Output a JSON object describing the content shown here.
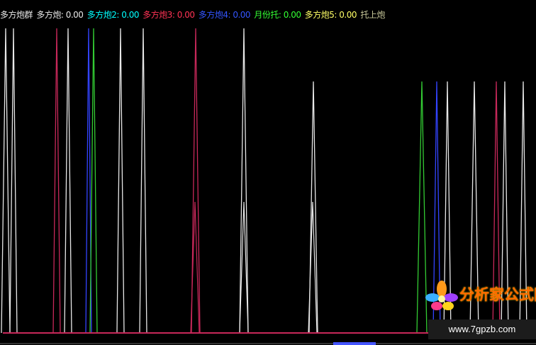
{
  "legend": {
    "title": "多方炮群",
    "items": [
      {
        "label": "多方炮: 0.00",
        "color": "#e8e8e8"
      },
      {
        "label": "多方炮2: 0.00",
        "color": "#00ffff"
      },
      {
        "label": "多方炮3: 0.00",
        "color": "#ff3355"
      },
      {
        "label": "多方炮4: 0.00",
        "color": "#3355ff"
      },
      {
        "label": "月份托: 0.00",
        "color": "#33ff33"
      },
      {
        "label": "多方炮5: 0.00",
        "color": "#ffff66"
      },
      {
        "label": "托上炮",
        "color": "#c8c89a"
      }
    ]
  },
  "watermark": {
    "name": "分析家公式网",
    "url": "www.7gpzb.com"
  },
  "colors": {
    "white_series": "#e8e8e8",
    "pink_series": "#c8285a",
    "blue_series": "#3344ff",
    "green_series": "#33cc33",
    "baseline": "#c8285a"
  },
  "chart_data": {
    "type": "line",
    "series": [
      {
        "name": "多方炮",
        "color": "#e8e8e8"
      },
      {
        "name": "多方炮3",
        "color": "#c8285a"
      },
      {
        "name": "多方炮4",
        "color": "#3344ff"
      },
      {
        "name": "月份托",
        "color": "#33cc33"
      }
    ]
  }
}
